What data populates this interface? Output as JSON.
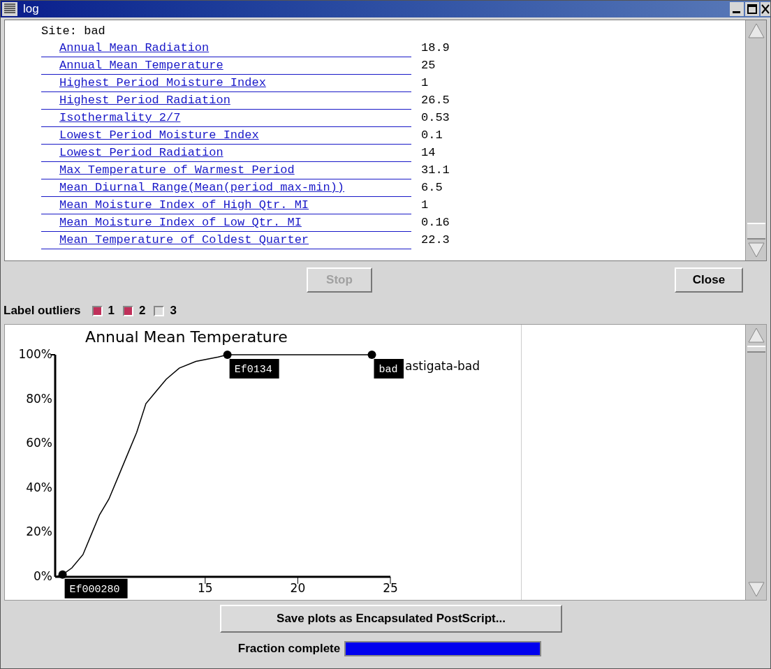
{
  "window": {
    "title": "log"
  },
  "log": {
    "site": "Site: bad",
    "rows": [
      {
        "name": "Annual Mean Radiation",
        "value": "18.9"
      },
      {
        "name": "Annual Mean Temperature",
        "value": "25"
      },
      {
        "name": "Highest Period Moisture Index",
        "value": "1"
      },
      {
        "name": "Highest Period Radiation",
        "value": "26.5"
      },
      {
        "name": "Isothermality 2/7",
        "value": "0.53"
      },
      {
        "name": "Lowest Period Moisture Index",
        "value": "0.1"
      },
      {
        "name": "Lowest Period Radiation",
        "value": "14"
      },
      {
        "name": "Max Temperature of Warmest Period",
        "value": "31.1"
      },
      {
        "name": "Mean Diurnal Range(Mean(period max-min))",
        "value": "6.5"
      },
      {
        "name": "Mean Moisture Index of High Qtr. MI",
        "value": "1"
      },
      {
        "name": "Mean Moisture Index of Low Qtr. MI",
        "value": "0.16"
      },
      {
        "name": "Mean Temperature of Coldest Quarter",
        "value": "22.3"
      }
    ]
  },
  "buttons": [
    {
      "label": "Stop",
      "disabled": true
    },
    {
      "label": "Close",
      "disabled": false
    }
  ],
  "outliers": {
    "label": "Label outliers",
    "options": [
      {
        "label": "1",
        "checked": true
      },
      {
        "label": "2",
        "checked": true
      },
      {
        "label": "3",
        "checked": false
      }
    ]
  },
  "plot": {
    "chart_data": {
      "type": "line",
      "title": "Annual Mean Temperature",
      "xlim": [
        6.9,
        25
      ],
      "ylim": [
        0,
        100
      ],
      "xticks": [
        15,
        20,
        25
      ],
      "yticks": [
        {
          "value": 0,
          "label": "0%"
        },
        {
          "value": 20,
          "label": "20%"
        },
        {
          "value": 40,
          "label": "40%"
        },
        {
          "value": 60,
          "label": "60%"
        },
        {
          "value": 80,
          "label": "80%"
        },
        {
          "value": 100,
          "label": "100%"
        }
      ],
      "x": [
        6.9,
        7.3,
        7.8,
        8.4,
        8.9,
        9.3,
        9.8,
        10.3,
        10.8,
        11.3,
        11.8,
        12.3,
        12.9,
        13.6,
        14.5,
        15.7,
        16.2,
        20,
        24
      ],
      "series": [
        {
          "color": "#000000",
          "values": [
            0,
            1,
            4,
            10,
            20,
            28,
            35,
            45,
            55,
            65,
            78,
            83,
            89,
            94,
            97,
            99,
            100,
            100,
            100
          ]
        }
      ],
      "annotations": [
        {
          "x": 7.3,
          "y": 1,
          "text": "Ef000280"
        },
        {
          "x": 16.2,
          "y": 100,
          "text": "Ef0134"
        },
        {
          "x": 24,
          "y": 100,
          "text": "bad"
        }
      ]
    },
    "extra_label": "astigata-bad"
  },
  "save_button": "Save plots as Encapsulated PostScript...",
  "progress": {
    "label": "Fraction complete",
    "level": 1
  }
}
